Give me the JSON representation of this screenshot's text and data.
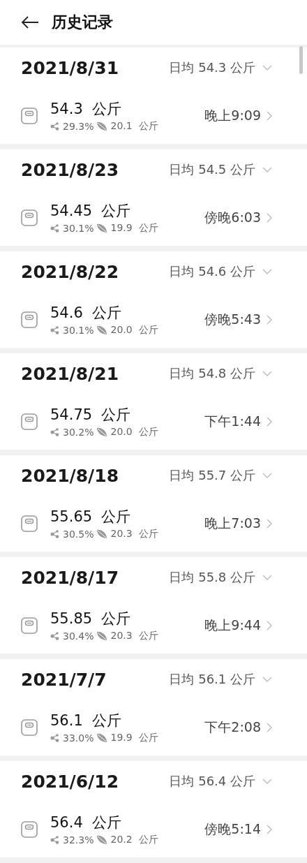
{
  "header": {
    "title": "历史记录"
  },
  "days": [
    {
      "date": "2021/8/31",
      "average": "日均 54.3  公斤",
      "expanded": false,
      "records": [
        {
          "weight": "54.3  公斤",
          "fat": "29.3%",
          "muscle": "20.1  公斤",
          "time": "晚上9:09"
        }
      ]
    },
    {
      "date": "2021/8/23",
      "average": "日均 54.5  公斤",
      "expanded": false,
      "records": [
        {
          "weight": "54.45  公斤",
          "fat": "30.1%",
          "muscle": "19.9  公斤",
          "time": "傍晚6:03"
        }
      ]
    },
    {
      "date": "2021/8/22",
      "average": "日均 54.6  公斤",
      "expanded": false,
      "records": [
        {
          "weight": "54.6  公斤",
          "fat": "30.1%",
          "muscle": "20.0  公斤",
          "time": "傍晚5:43"
        }
      ]
    },
    {
      "date": "2021/8/21",
      "average": "日均 54.8  公斤",
      "expanded": false,
      "records": [
        {
          "weight": "54.75  公斤",
          "fat": "30.2%",
          "muscle": "20.0  公斤",
          "time": "下午1:44"
        }
      ]
    },
    {
      "date": "2021/8/18",
      "average": "日均 55.7  公斤",
      "expanded": false,
      "records": [
        {
          "weight": "55.65  公斤",
          "fat": "30.5%",
          "muscle": "20.3  公斤",
          "time": "晚上7:03"
        }
      ]
    },
    {
      "date": "2021/8/17",
      "average": "日均 55.8  公斤",
      "expanded": false,
      "records": [
        {
          "weight": "55.85  公斤",
          "fat": "30.4%",
          "muscle": "20.3  公斤",
          "time": "晚上9:44"
        }
      ]
    },
    {
      "date": "2021/7/7",
      "average": "日均 56.1  公斤",
      "expanded": false,
      "records": [
        {
          "weight": "56.1  公斤",
          "fat": "33.0%",
          "muscle": "19.9  公斤",
          "time": "下午2:08"
        }
      ]
    },
    {
      "date": "2021/6/12",
      "average": "日均 56.4  公斤",
      "expanded": false,
      "records": [
        {
          "weight": "56.4  公斤",
          "fat": "32.3%",
          "muscle": "20.2  公斤",
          "time": "傍晚5:14"
        }
      ]
    }
  ]
}
